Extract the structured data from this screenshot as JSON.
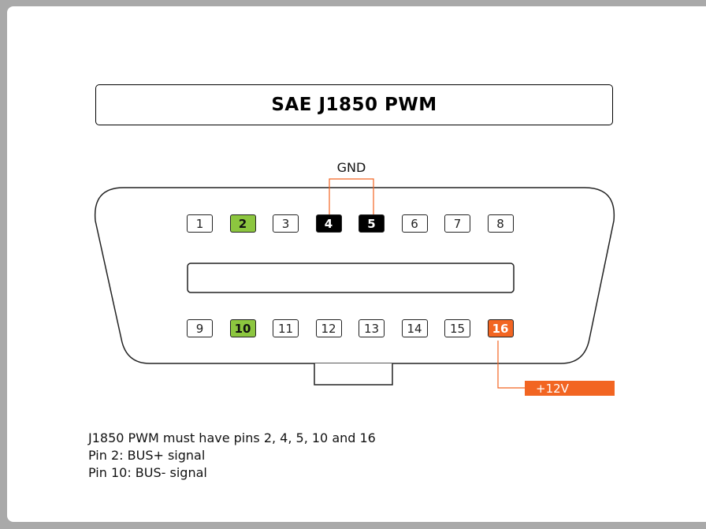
{
  "title": "SAE J1850 PWM",
  "gnd_label": "GND",
  "power_label": "+12V",
  "colors": {
    "bus": "#8cc63f",
    "ground": "#000000",
    "power": "#f26522",
    "frame": "#a9a9a9"
  },
  "top_pins": [
    {
      "num": "1",
      "kind": "plain"
    },
    {
      "num": "2",
      "kind": "green"
    },
    {
      "num": "3",
      "kind": "plain"
    },
    {
      "num": "4",
      "kind": "black"
    },
    {
      "num": "5",
      "kind": "black"
    },
    {
      "num": "6",
      "kind": "plain"
    },
    {
      "num": "7",
      "kind": "plain"
    },
    {
      "num": "8",
      "kind": "plain"
    }
  ],
  "bottom_pins": [
    {
      "num": "9",
      "kind": "plain"
    },
    {
      "num": "10",
      "kind": "green"
    },
    {
      "num": "11",
      "kind": "plain"
    },
    {
      "num": "12",
      "kind": "plain"
    },
    {
      "num": "13",
      "kind": "plain"
    },
    {
      "num": "14",
      "kind": "plain"
    },
    {
      "num": "15",
      "kind": "plain"
    },
    {
      "num": "16",
      "kind": "orange"
    }
  ],
  "notes": [
    "J1850 PWM must have pins 2, 4, 5, 10 and 16",
    "Pin 2: BUS+ signal",
    "Pin 10: BUS- signal"
  ]
}
